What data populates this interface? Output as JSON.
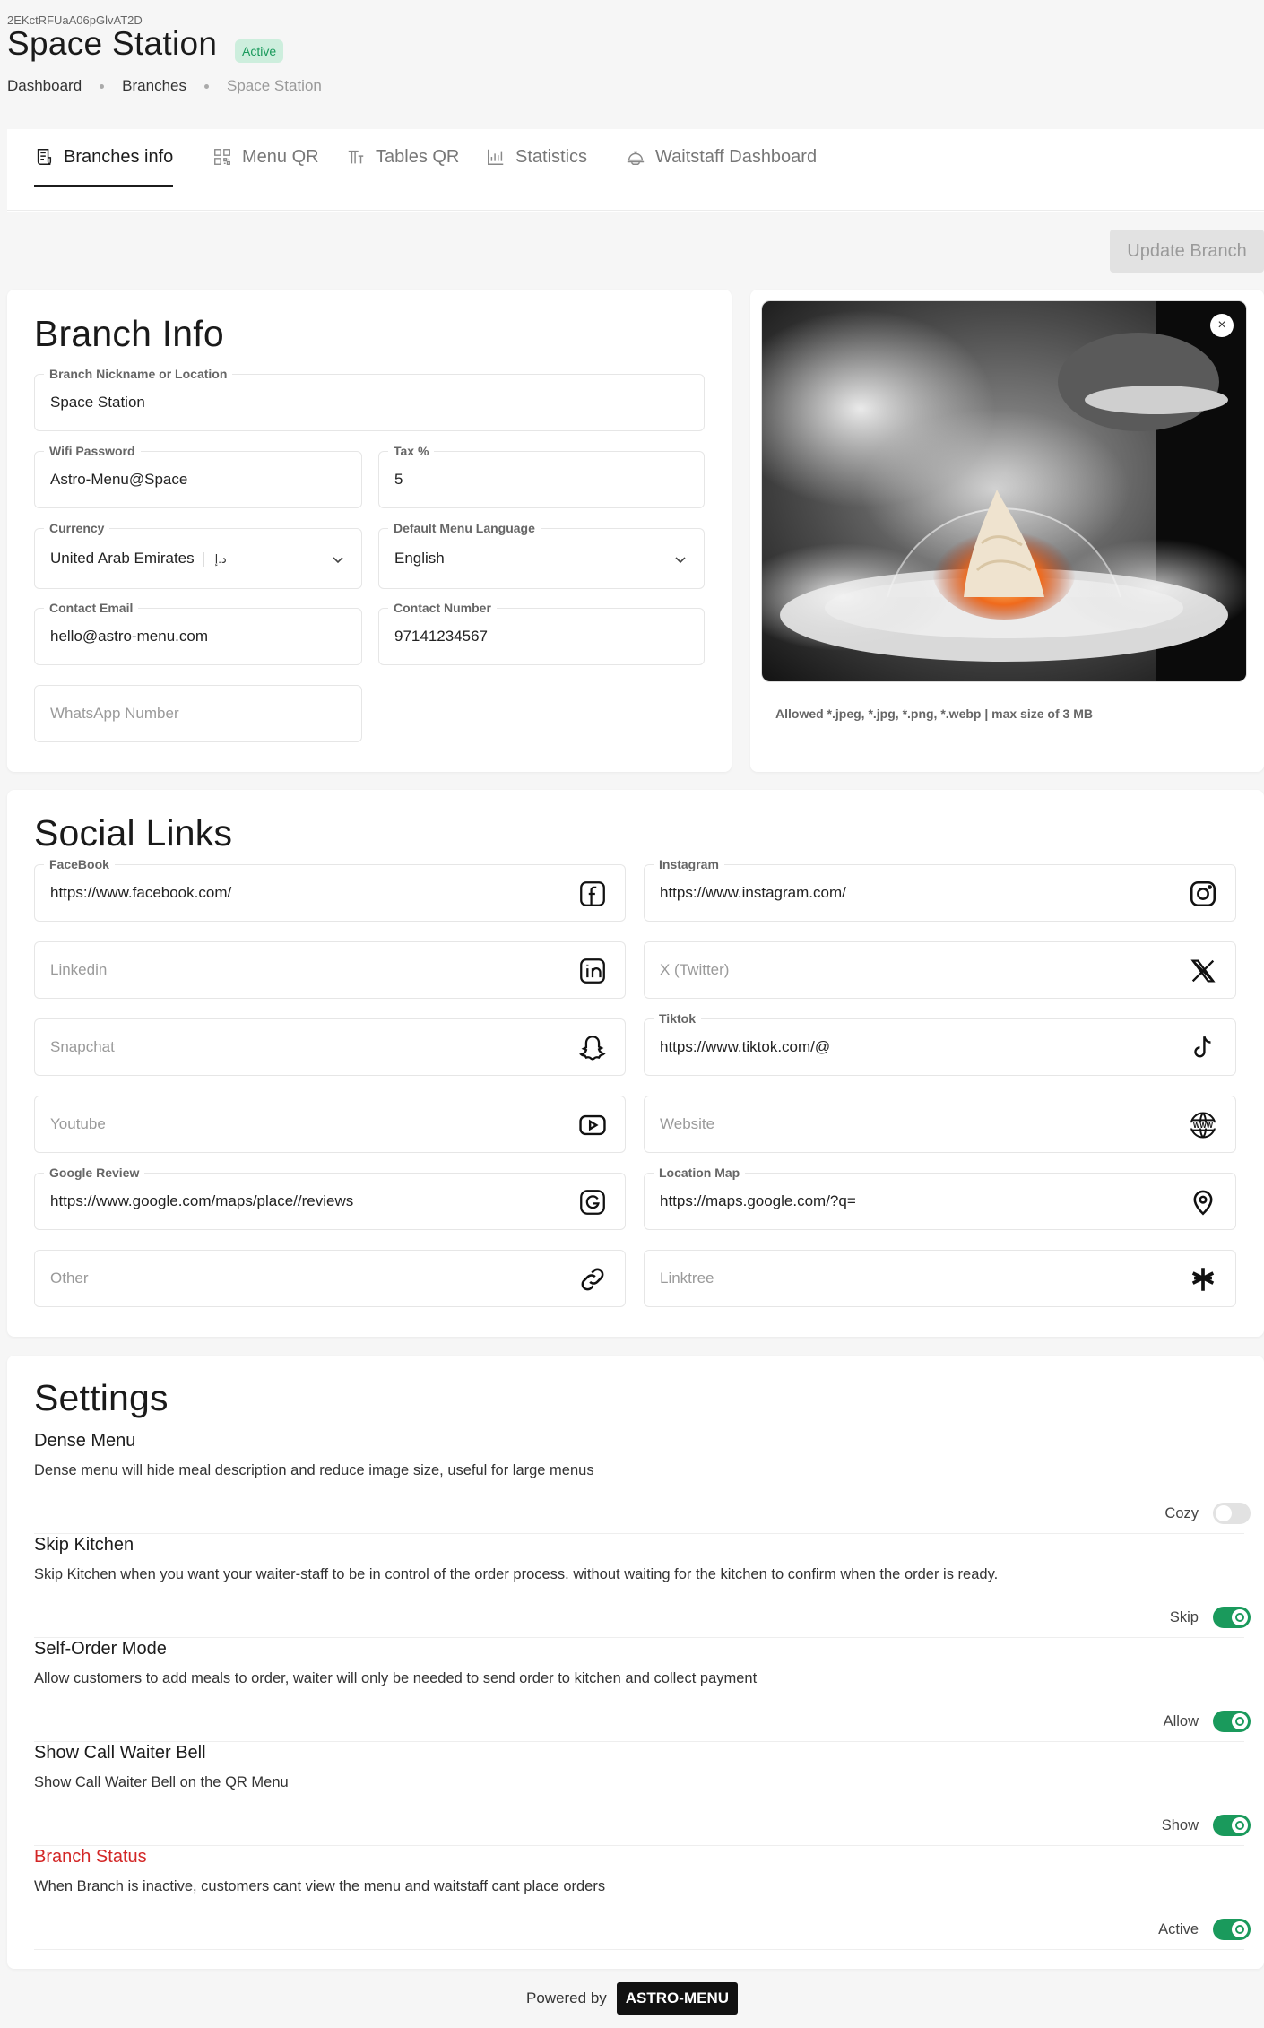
{
  "header": {
    "id": "2EKctRFUaA06pGlvAT2D",
    "title": "Space Station",
    "badge": "Active",
    "breadcrumb": [
      "Dashboard",
      "Branches",
      "Space Station"
    ]
  },
  "tabs": [
    {
      "label": "Branches info",
      "icon": "receipt-icon"
    },
    {
      "label": "Menu QR",
      "icon": "qr-icon"
    },
    {
      "label": "Tables QR",
      "icon": "table-icon"
    },
    {
      "label": "Statistics",
      "icon": "bar-chart-icon"
    },
    {
      "label": "Waitstaff Dashboard",
      "icon": "cloche-icon"
    }
  ],
  "update_button": "Update Branch",
  "branch_info": {
    "title": "Branch Info",
    "nickname": {
      "label": "Branch Nickname or Location",
      "value": "Space Station"
    },
    "wifi": {
      "label": "Wifi Password",
      "value": "Astro-Menu@Space"
    },
    "tax": {
      "label": "Tax %",
      "value": "5"
    },
    "currency": {
      "label": "Currency",
      "value": "United Arab Emirates",
      "symbol": "د.إ"
    },
    "language": {
      "label": "Default Menu Language",
      "value": "English"
    },
    "email": {
      "label": "Contact Email",
      "value": "hello@astro-menu.com"
    },
    "phone": {
      "label": "Contact Number",
      "value": "97141234567"
    },
    "whatsapp": {
      "placeholder": "WhatsApp Number"
    }
  },
  "image_upload": {
    "caption": "Allowed *.jpeg, *.jpg, *.png, *.webp | max size of 3 MB",
    "close": "×"
  },
  "social": {
    "title": "Social Links",
    "facebook": {
      "label": "FaceBook",
      "value": "https://www.facebook.com/",
      "icon": "facebook-icon"
    },
    "instagram": {
      "label": "Instagram",
      "value": "https://www.instagram.com/",
      "icon": "instagram-icon"
    },
    "linkedin": {
      "placeholder": "Linkedin",
      "icon": "linkedin-icon"
    },
    "twitter": {
      "placeholder": "X (Twitter)",
      "icon": "x-icon"
    },
    "snapchat": {
      "placeholder": "Snapchat",
      "icon": "snapchat-icon"
    },
    "tiktok": {
      "label": "Tiktok",
      "value": "https://www.tiktok.com/@",
      "icon": "tiktok-icon"
    },
    "youtube": {
      "placeholder": "Youtube",
      "icon": "youtube-icon"
    },
    "website": {
      "placeholder": "Website",
      "icon": "www-icon"
    },
    "google_review": {
      "label": "Google Review",
      "value": "https://www.google.com/maps/place//reviews",
      "icon": "google-icon"
    },
    "location_map": {
      "label": "Location Map",
      "value": "https://maps.google.com/?q=",
      "icon": "map-pin-icon"
    },
    "other": {
      "placeholder": "Other",
      "icon": "link-icon"
    },
    "linktree": {
      "placeholder": "Linktree",
      "icon": "linktree-icon"
    }
  },
  "settings": {
    "title": "Settings",
    "items": [
      {
        "title": "Dense Menu",
        "desc": "Dense menu will hide meal description and reduce image size, useful for large menus",
        "toggle_label": "Cozy",
        "on": false
      },
      {
        "title": "Skip Kitchen",
        "desc": "Skip Kitchen when you want your waiter-staff to be in control of the order process. without waiting for the kitchen to confirm when the order is ready.",
        "toggle_label": "Skip",
        "on": true
      },
      {
        "title": "Self-Order Mode",
        "desc": "Allow customers to add meals to order, waiter will only be needed to send order to kitchen and collect payment",
        "toggle_label": "Allow",
        "on": true
      },
      {
        "title": "Show Call Waiter Bell",
        "desc": "Show Call Waiter Bell on the QR Menu",
        "toggle_label": "Show",
        "on": true
      },
      {
        "title": "Branch Status",
        "desc": "When Branch is inactive, customers cant view the menu and waitstaff cant place orders",
        "toggle_label": "Active",
        "on": true
      }
    ]
  },
  "footer": {
    "powered_by": "Powered by",
    "brand": "ASTRO-MENU"
  },
  "colors": {
    "accent_green": "#1a9a5c",
    "badge_bg": "#cdeedd",
    "danger_red": "#d32626",
    "background": "#f6f6f6"
  }
}
